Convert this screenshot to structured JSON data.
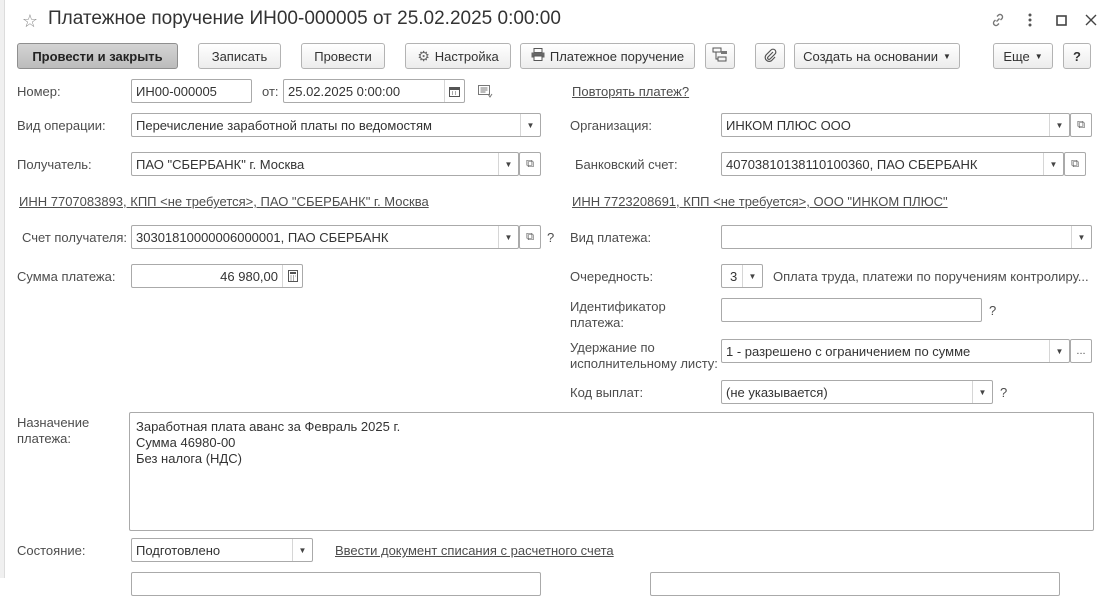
{
  "window": {
    "title": "Платежное поручение ИН00-000005 от 25.02.2025 0:00:00"
  },
  "toolbar": {
    "post_close": "Провести и закрыть",
    "save": "Записать",
    "post": "Провести",
    "settings": "Настройка",
    "print_order": "Платежное поручение",
    "create_based": "Создать на основании",
    "more": "Еще",
    "help": "?"
  },
  "form": {
    "number_label": "Номер:",
    "number_value": "ИН00-000005",
    "date_label": "от:",
    "date_value": "25.02.2025  0:00:00",
    "repeat_link": "Повторять платеж?",
    "op_type_label": "Вид операции:",
    "op_type_value": "Перечисление заработной платы по ведомостям",
    "org_label": "Организация:",
    "org_value": "ИНКОМ ПЛЮС ООО",
    "recipient_label": "Получатель:",
    "recipient_value": "ПАО \"СБЕРБАНК\" г. Москва",
    "bank_account_label": "Банковский счет:",
    "bank_account_value": "40703810138110100360, ПАО СБЕРБАНК",
    "recipient_inn_link": "ИНН 7707083893, КПП <не требуется>, ПАО \"СБЕРБАНК\" г. Москва",
    "org_inn_link": "ИНН 7723208691, КПП <не требуется>, ООО \"ИНКОМ ПЛЮС\"",
    "recipient_account_label": "Счет получателя:",
    "recipient_account_value": "30301810000006000001, ПАО СБЕРБАНК",
    "payment_type_label": "Вид платежа:",
    "payment_type_value": "",
    "amount_label": "Сумма платежа:",
    "amount_value": "46 980,00",
    "priority_label": "Очередность:",
    "priority_value": "3",
    "priority_desc": "Оплата труда, платежи по поручениям контролиру...",
    "payment_id_label": "Идентификатор платежа:",
    "payment_id_value": "",
    "withholding_label": "Удержание по исполнительному листу:",
    "withholding_value": "1 - разрешено с ограничением по сумме",
    "payout_code_label": "Код выплат:",
    "payout_code_value": "(не указывается)",
    "purpose_label": "Назначение платежа:",
    "purpose_text": "Заработная плата аванс за Февраль 2025 г.\nСумма 46980-00\nБез налога (НДС)",
    "status_label": "Состояние:",
    "status_value": "Подготовлено",
    "write_off_link": "Ввести документ списания с расчетного счета",
    "question_mark": "?"
  }
}
